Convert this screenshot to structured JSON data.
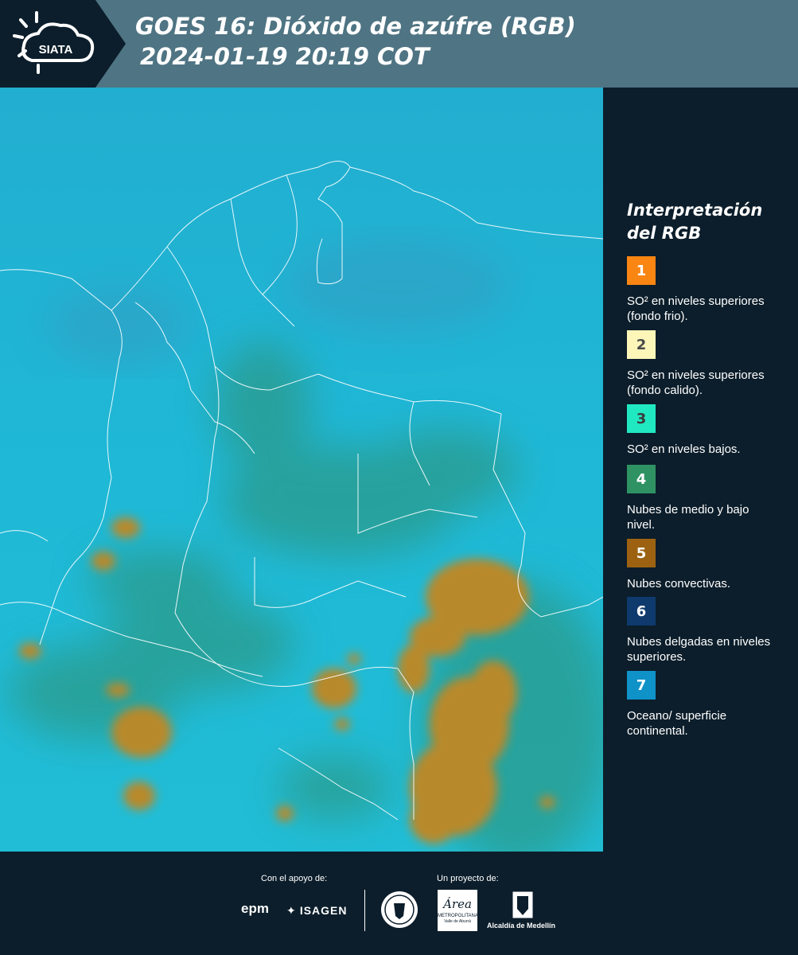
{
  "header": {
    "logo_text": "SIATA",
    "title_line1": "GOES 16: Dióxido de azúfre (RGB)",
    "title_line2": "2024-01-19 20:19 COT"
  },
  "legend": {
    "title_line1": "Interpretación",
    "title_line2": "del RGB",
    "items": [
      {
        "number": "1",
        "color": "#f98513",
        "label": "SO² en niveles superiores (fondo frio)."
      },
      {
        "number": "2",
        "color": "#fdf6b9",
        "label": "SO² en niveles superiores (fondo calido)."
      },
      {
        "number": "3",
        "color": "#20e9c2",
        "label": "SO² en niveles bajos."
      },
      {
        "number": "4",
        "color": "#2f9263",
        "label": "Nubes de medio y bajo nivel."
      },
      {
        "number": "5",
        "color": "#9c6212",
        "label": "Nubes convectivas."
      },
      {
        "number": "6",
        "color": "#0e3a6d",
        "label": "Nubes delgadas en niveles superiores."
      },
      {
        "number": "7",
        "color": "#0f92c8",
        "label": "Oceano/ superficie continental."
      }
    ]
  },
  "footer": {
    "support_label": "Con el apoyo de:",
    "project_label": "Un proyecto de:",
    "sponsor1": "epm",
    "sponsor2": "ISAGEN",
    "partner1_line1": "Área",
    "partner1_line2": "METROPOLITANA",
    "partner1_line3": "Valle de Aburrá",
    "partner2": "Alcaldía de Medellín"
  },
  "colors": {
    "background": "#0c1e2b",
    "header": "#4f7483",
    "ocean": "#1fb1d0",
    "convective": "#b38a2a",
    "low_cloud": "#2f8f6f"
  }
}
